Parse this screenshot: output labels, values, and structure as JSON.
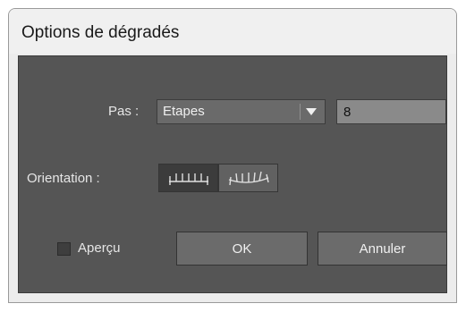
{
  "dialog": {
    "title": "Options de dégradés",
    "spacing_label": "Pas :",
    "spacing_value": "Etapes",
    "steps_value": "8",
    "orientation_label": "Orientation :",
    "orientation_options": [
      "align-to-page-icon",
      "align-to-path-icon"
    ],
    "orientation_selected": "align-to-page-icon",
    "preview_label": "Aperçu",
    "preview_checked": false,
    "ok_label": "OK",
    "cancel_label": "Annuler"
  },
  "colors": {
    "panel_bg": "#555555",
    "field_bg": "#6a6a6a",
    "input_bg": "#8a8a8a",
    "selected_toggle_bg": "#3c3c3c",
    "text": "#e6e6e6"
  }
}
